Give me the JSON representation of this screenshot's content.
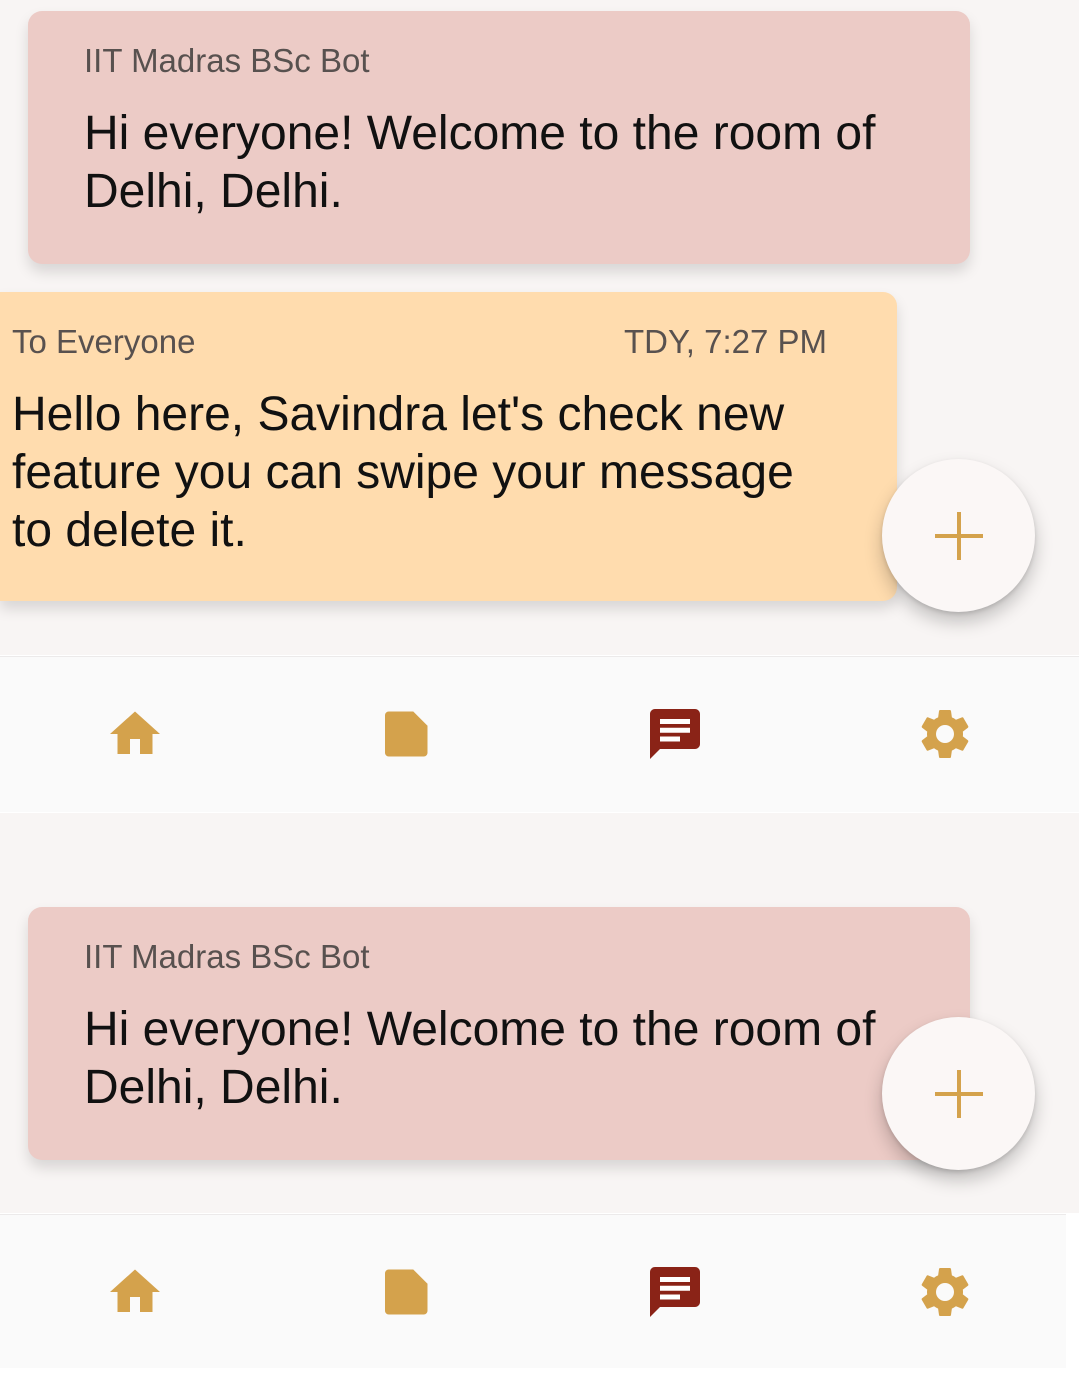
{
  "colors": {
    "bot_bubble": "#eccbc6",
    "user_bubble": "#ffdcae",
    "accent": "#d4a24c",
    "active_icon": "#8a2317",
    "fab_background": "#fbf7f6"
  },
  "screens": [
    {
      "messages": [
        {
          "sender": "IIT Madras BSc Bot",
          "text": "Hi everyone! Welcome to the room of Delhi, Delhi."
        },
        {
          "recipient": "To Everyone",
          "timestamp": "TDY, 7:27 PM",
          "text": "Hello here, Savindra let's check new feature you can swipe your message to delete it."
        }
      ],
      "fab_icon": "plus-icon",
      "nav": [
        {
          "icon": "home-icon"
        },
        {
          "icon": "note-icon"
        },
        {
          "icon": "chat-icon",
          "active": true
        },
        {
          "icon": "gear-icon"
        }
      ]
    },
    {
      "messages": [
        {
          "sender": "IIT Madras BSc Bot",
          "text": "Hi everyone! Welcome to the room of Delhi, Delhi."
        }
      ],
      "fab_icon": "plus-icon",
      "nav": [
        {
          "icon": "home-icon"
        },
        {
          "icon": "note-icon"
        },
        {
          "icon": "chat-icon",
          "active": true
        },
        {
          "icon": "gear-icon"
        }
      ]
    }
  ]
}
